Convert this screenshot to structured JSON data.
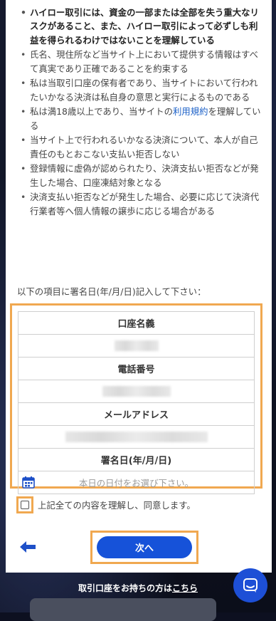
{
  "terms": [
    {
      "text": "ハイロー取引には、資金の一部または全部を失う重大なリスクがあること、また、ハイロー取引によって必ずしも利益を得られるわけではないことを理解している",
      "bold": true
    },
    {
      "text": "氏名、現住所など当サイト上において提供する情報はすべて真実であり正確であることを約束する"
    },
    {
      "text": "私は当取引口座の保有者であり、当サイトにおいて行われたいかなる決済は私自身の意思と実行によるものである"
    },
    {
      "text_before": "私は満18歳以上であり、当サイトの",
      "link": "利用規約",
      "text_after": "を理解している"
    },
    {
      "text": "当サイト上で行われるいかなる決済について、本人が自己責任のもとおこない支払い拒否しない"
    },
    {
      "text": "登録情報に虚偽が認められたり、決済支払い拒否などが発生した場合、口座凍結対象となる"
    },
    {
      "text": "決済支払い拒否などが発生した場合、必要に応じて決済代行業者等へ個人情報の譲歩に応じる場合がある"
    }
  ],
  "instruction": "以下の項目に署名日(年/月/日)記入して下さい：",
  "form": {
    "account_name_label": "口座名義",
    "phone_label": "電話番号",
    "email_label": "メールアドレス",
    "sign_date_label": "署名日(年/月/日)",
    "date_placeholder": "本日の日付をお選び下さい。"
  },
  "consent_label": "上記全ての内容を理解し、同意します。",
  "next_label": "次へ",
  "account_prompt": "取引口座をお持ちの方は",
  "account_link": "こちら",
  "colors": {
    "accent": "#1652d9",
    "highlight": "#f0a850"
  },
  "icons": [
    "back-arrow-icon",
    "calendar-icon",
    "chat-icon"
  ]
}
